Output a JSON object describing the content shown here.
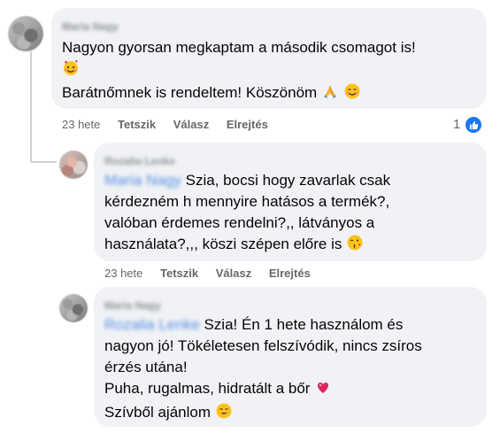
{
  "comments": [
    {
      "author": "Maria Nagy",
      "lines": [
        "Nagyon gyorsan megkaptam a második csomagot is!",
        "",
        "Barátnőmnek is rendeltem! Köszönöm"
      ],
      "time": "23 hete",
      "like": "Tetszik",
      "reply": "Válasz",
      "hide": "Elrejtés",
      "reaction_count": "1",
      "reaction_icon": "thumbs-up-icon"
    },
    {
      "author": "Rozalia Lenke",
      "mention": "Maria Nagy",
      "line1": " Szia, bocsi hogy zavarlak csak",
      "lines": [
        "kérdezném h mennyire hatásos a termék?,",
        "valóban érdemes rendelni?,, látványos a",
        "használata?,,, köszi szépen előre is"
      ],
      "time": "23 hete",
      "like": "Tetszik",
      "reply": "Válasz",
      "hide": "Elrejtés"
    },
    {
      "author": "Maria Nagy",
      "mention": "Rozalia Lenke",
      "line1": " Szia! Én 1 hete használom és",
      "lines": [
        "nagyon jó! Tökéletesen felszívódik, nincs zsíros",
        "érzés utána!",
        "Puha, rugalmas, hidratált a bőr",
        "Szívből ajánlom"
      ]
    }
  ],
  "colors": {
    "bubble": "#f0f2f5",
    "meta": "#65676b",
    "link": "#216fdb",
    "like_blue": "#1877f2"
  }
}
